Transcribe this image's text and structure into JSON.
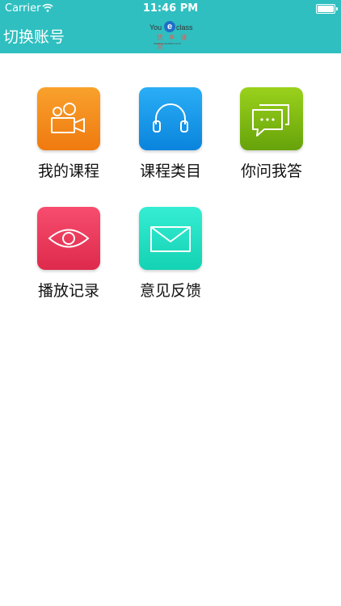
{
  "status_bar": {
    "carrier": "Carrier",
    "time": "11:46 PM"
  },
  "header": {
    "switch_account": "切换账号",
    "logo": {
      "left_text": "You",
      "mark": "e",
      "right_text": "class",
      "subtitle": "优 享 课 堂",
      "url": "www.youclass.com"
    }
  },
  "colors": {
    "header_bg": "#2fbfc0",
    "orange": "#f28a1a",
    "blue": "#1b9be9",
    "green": "#7cbb12",
    "pink": "#ea3a5b",
    "teal": "#22e0c2"
  },
  "menu": {
    "items": [
      {
        "label": "我的课程",
        "icon": "video-camera-icon"
      },
      {
        "label": "课程类目",
        "icon": "headphones-icon"
      },
      {
        "label": "你问我答",
        "icon": "chat-bubbles-icon"
      },
      {
        "label": "播放记录",
        "icon": "eye-icon"
      },
      {
        "label": "意见反馈",
        "icon": "envelope-icon"
      }
    ]
  }
}
